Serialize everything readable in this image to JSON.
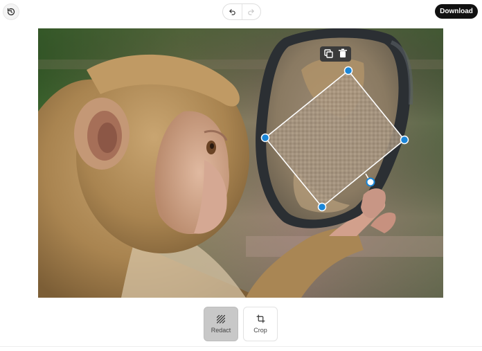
{
  "header": {
    "history_icon": "history-icon",
    "undo_icon": "undo-icon",
    "redo_icon": "redo-icon",
    "redo_enabled": false,
    "download_label": "Download"
  },
  "editor": {
    "image_subject": "macaque-monkey-with-mirror",
    "selection_toolbar": {
      "duplicate_icon": "duplicate-icon",
      "delete_icon": "trash-icon"
    },
    "selection_handle_color": "#1a86d8",
    "redaction_style": "pixelated-blur"
  },
  "tools": [
    {
      "label": "Redact",
      "icon": "redact-icon",
      "active": true
    },
    {
      "label": "Crop",
      "icon": "crop-icon",
      "active": false
    }
  ]
}
